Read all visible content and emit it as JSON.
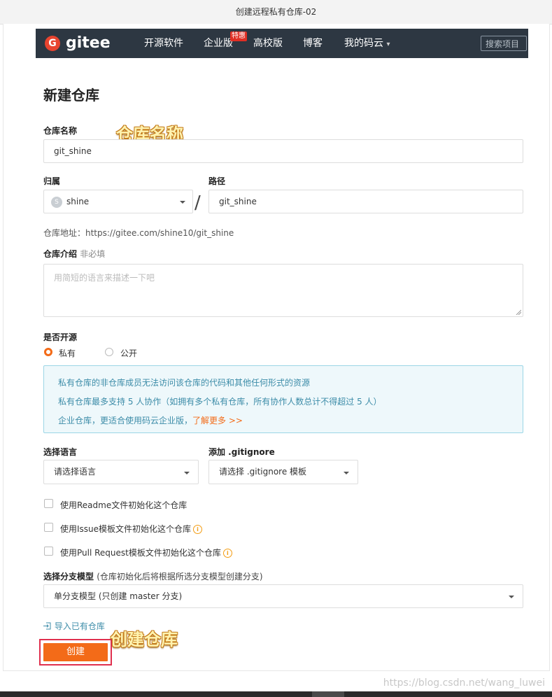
{
  "window": {
    "title": "创建远程私有仓库-02"
  },
  "navbar": {
    "logo_mark": "G",
    "logo_text": "gitee",
    "items": [
      "开源软件",
      "企业版",
      "高校版",
      "博客",
      "我的码云"
    ],
    "badge": "特惠",
    "dropdown_caret": "▾",
    "search_placeholder": "搜索项目"
  },
  "form": {
    "page_title": "新建仓库",
    "repo_name": {
      "label": "仓库名称",
      "value": "git_shine"
    },
    "owner": {
      "label": "归属",
      "avatar_letter": "S",
      "value": "shine"
    },
    "separator": "/",
    "path": {
      "label": "路径",
      "value": "git_shine"
    },
    "repo_url": "仓库地址：https://gitee.com/shine10/git_shine",
    "description": {
      "label": "仓库介绍",
      "optional": "非必填",
      "placeholder": "用简短的语言来描述一下吧"
    },
    "visibility": {
      "label": "是否开源",
      "private": "私有",
      "public": "公开",
      "selected": "private"
    },
    "info": {
      "line1": "私有仓库的非仓库成员无法访问该仓库的代码和其他任何形式的资源",
      "line2": "私有仓库最多支持 5 人协作（如拥有多个私有仓库，所有协作人数总计不得超过 5 人）",
      "line3": "企业仓库，更适合使用码云企业版，",
      "link": "了解更多 >>"
    },
    "language": {
      "label": "选择语言",
      "value": "请选择语言"
    },
    "gitignore": {
      "label": "添加 .gitignore",
      "value": "请选择 .gitignore 模板"
    },
    "checkboxes": [
      {
        "label": "使用Readme文件初始化这个仓库",
        "info": false
      },
      {
        "label": "使用Issue模板文件初始化这个仓库",
        "info": true
      },
      {
        "label": "使用Pull Request模板文件初始化这个仓库",
        "info": true
      }
    ],
    "branch_model": {
      "label": "选择分支模型",
      "hint": "(仓库初始化后将根据所选分支模型创建分支)",
      "value": "单分支模型 (只创建 master 分支)"
    },
    "import_link": "导入已有仓库",
    "submit": "创建"
  },
  "annotations": {
    "name": "仓库名称",
    "create": "创建仓库"
  },
  "watermark": "https://blog.csdn.net/wang_luwei",
  "colors": {
    "accent": "#f36b18",
    "nav_bg": "#2d3742",
    "info_text": "#3c8ca8",
    "highlight": "#e0304e"
  }
}
